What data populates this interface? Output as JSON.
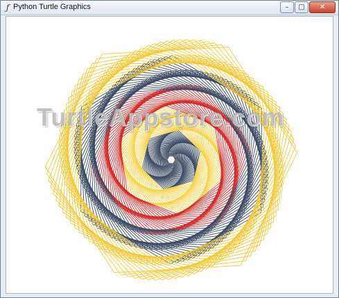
{
  "window": {
    "title": "Python Turtle Graphics",
    "controls": {
      "minimize": "–",
      "maximize": "□",
      "close": "✕"
    }
  },
  "canvas": {
    "watermark": "TurtleAppstore.com",
    "drawing": {
      "shape": "hexagon-spiral",
      "colors": [
        "#3b4a63",
        "#d32d2d",
        "#f0c93a",
        "#f6d34a"
      ],
      "background": "#ffffff"
    }
  }
}
